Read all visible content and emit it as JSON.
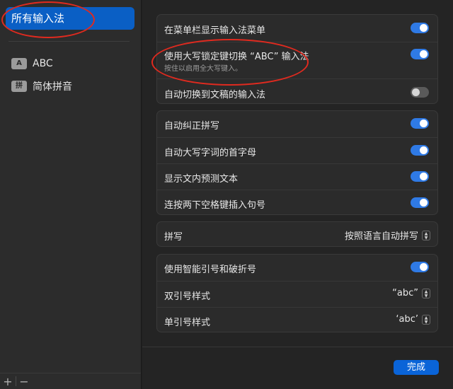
{
  "sidebar": {
    "selected": "所有输入法",
    "items": [
      {
        "badge": "A",
        "label": "ABC"
      },
      {
        "badge": "拼",
        "label": "简体拼音"
      }
    ],
    "add": "+",
    "remove": "−"
  },
  "groups": {
    "menu": [
      {
        "label": "在菜单栏显示输入法菜单",
        "toggle": true
      },
      {
        "label": "使用大写锁定键切换 “ABC” 输入法",
        "sub": "按住以启用全大写键入。",
        "toggle": true
      },
      {
        "label": "自动切换到文稿的输入法",
        "toggle": false
      }
    ],
    "auto": [
      {
        "label": "自动纠正拼写",
        "toggle": true
      },
      {
        "label": "自动大写字词的首字母",
        "toggle": true
      },
      {
        "label": "显示文内预测文本",
        "toggle": true
      },
      {
        "label": "连按两下空格键插入句号",
        "toggle": true
      }
    ],
    "spelling": {
      "label": "拼写",
      "value": "按照语言自动拼写"
    },
    "quotes": [
      {
        "label": "使用智能引号和破折号",
        "toggle": true
      },
      {
        "label": "双引号样式",
        "value": "“abc”"
      },
      {
        "label": "单引号样式",
        "value": "‘abc’"
      }
    ]
  },
  "done_label": "完成",
  "colors": {
    "accent": "#2f7ae5",
    "selection": "#0a5fc5",
    "annotation": "#e02a1f"
  }
}
